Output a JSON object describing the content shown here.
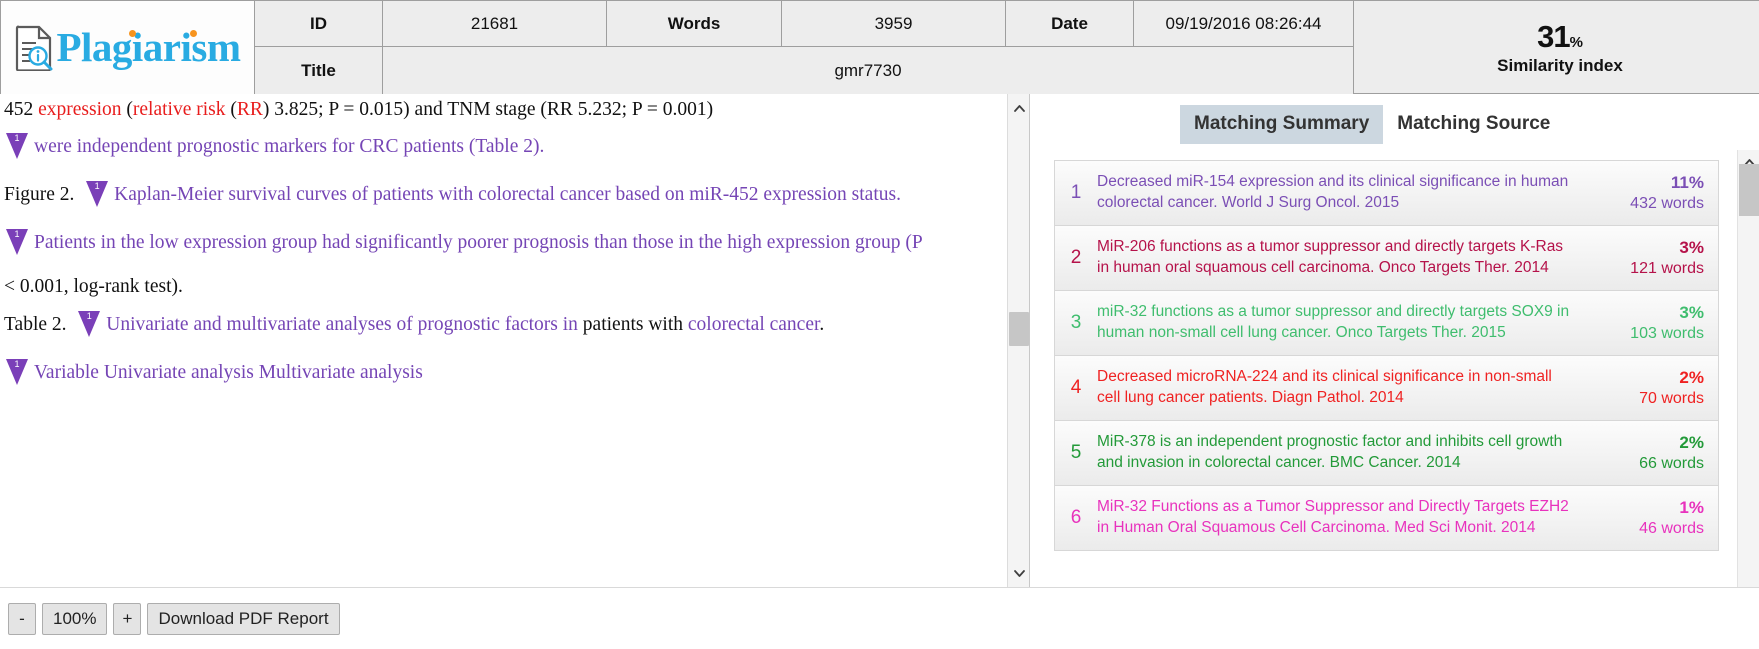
{
  "brand": {
    "name": "Plagiarism",
    "icon": "document-search-icon"
  },
  "header": {
    "id_label": "ID",
    "id_value": "21681",
    "words_label": "Words",
    "words_value": "3959",
    "date_label": "Date",
    "date_value": "09/19/2016 08:26:44",
    "title_label": "Title",
    "title_value": "gmr7730",
    "similarity_value": "31",
    "similarity_percent": "%",
    "similarity_label": "Similarity index"
  },
  "document": {
    "lines": [
      {
        "marker": null,
        "segments": [
          {
            "text": "452 ",
            "color": "black"
          },
          {
            "text": "expression",
            "color": "red"
          },
          {
            "text": " (",
            "color": "black"
          },
          {
            "text": "relative risk",
            "color": "red"
          },
          {
            "text": " (",
            "color": "black"
          },
          {
            "text": "RR",
            "color": "red"
          },
          {
            "text": ") 3.825; P = 0.015) and TNM stage (RR 5.232; P = 0.001)",
            "color": "black"
          }
        ]
      },
      {
        "marker": "1",
        "segments": [
          {
            "text": "were independent prognostic markers for CRC patients (Table 2).",
            "color": "purple"
          }
        ]
      },
      {
        "prefix": "Figure 2.",
        "marker": "1",
        "segments": [
          {
            "text": "Kaplan-Meier survival curves of patients with colorectal cancer based on miR-452 expression status.",
            "color": "purple"
          }
        ]
      },
      {
        "marker": "1",
        "segments": [
          {
            "text": "Patients in the low expression group had significantly poorer prognosis than those in the high expression group (P",
            "color": "purple"
          }
        ]
      },
      {
        "marker": null,
        "segments": [
          {
            "text": "< 0.001, log-rank test).",
            "color": "black"
          }
        ]
      },
      {
        "prefix": "Table 2.",
        "marker": "1",
        "segments": [
          {
            "text": "Univariate and multivariate analyses of prognostic factors in ",
            "color": "purple"
          },
          {
            "text": "patients with ",
            "color": "black"
          },
          {
            "text": "colorectal cancer",
            "color": "purple"
          },
          {
            "text": ".",
            "color": "black"
          }
        ]
      },
      {
        "marker": "1",
        "segments": [
          {
            "text": "Variable Univariate analysis Multivariate analysis",
            "color": "purple"
          }
        ]
      }
    ]
  },
  "right_panel": {
    "tabs": [
      {
        "label": "Matching Summary",
        "active": true
      },
      {
        "label": "Matching Source",
        "active": false
      }
    ],
    "sources": [
      {
        "index": "1",
        "title": "Decreased miR-154 expression and its clinical significance in human colorectal cancer. World J Surg Oncol. 2015",
        "percent": "11%",
        "words": "432 words",
        "color": "#7b4fb5"
      },
      {
        "index": "2",
        "title": "MiR-206 functions as a tumor suppressor and directly targets K-Ras in human oral squamous cell carcinoma. Onco Targets Ther. 2014",
        "percent": "3%",
        "words": "121 words",
        "color": "#b5124a"
      },
      {
        "index": "3",
        "title": "miR-32 functions as a tumor suppressor and directly targets SOX9 in human non-small cell lung cancer. Onco Targets Ther. 2015",
        "percent": "3%",
        "words": "103 words",
        "color": "#3fbd6e"
      },
      {
        "index": "4",
        "title": "Decreased microRNA-224 and its clinical significance in non-small cell lung cancer patients. Diagn Pathol. 2014",
        "percent": "2%",
        "words": "70 words",
        "color": "#ef2222"
      },
      {
        "index": "5",
        "title": "MiR-378 is an independent prognostic factor and inhibits cell growth and invasion in colorectal cancer. BMC Cancer. 2014",
        "percent": "2%",
        "words": "66 words",
        "color": "#239a39"
      },
      {
        "index": "6",
        "title": "MiR-32 Functions as a Tumor Suppressor and Directly Targets EZH2 in Human Oral Squamous Cell Carcinoma. Med Sci Monit. 2014",
        "percent": "1%",
        "words": "46 words",
        "color": "#e832bd"
      }
    ]
  },
  "footer": {
    "zoom_out_label": "-",
    "zoom_level": "100%",
    "zoom_in_label": "+",
    "download_label": "Download PDF Report"
  }
}
